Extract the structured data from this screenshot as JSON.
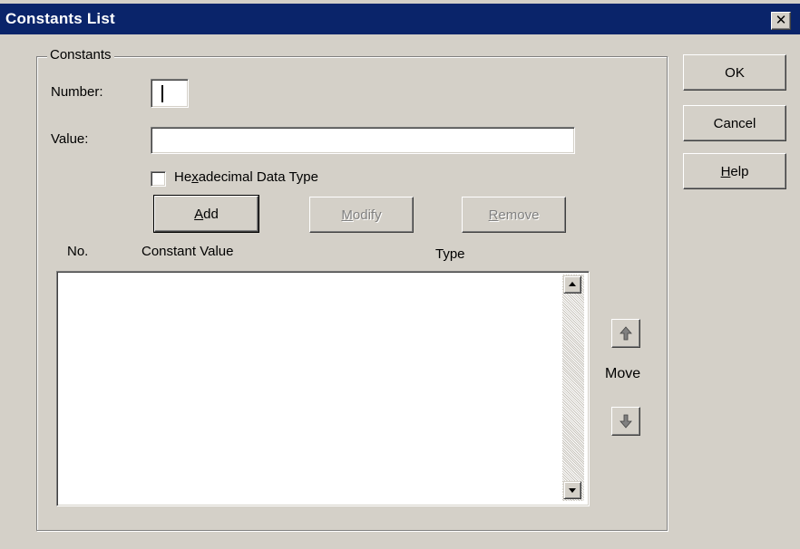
{
  "window": {
    "title": "Constants List",
    "close_label": "✕"
  },
  "group": {
    "label": "Constants"
  },
  "number": {
    "label": "Number:",
    "value": ""
  },
  "value": {
    "label": "Value:",
    "value": ""
  },
  "hex": {
    "label_pre": "He",
    "label_access": "x",
    "label_post": "adecimal Data Type",
    "checked": false
  },
  "buttons": {
    "add": {
      "access": "A",
      "rest": "dd"
    },
    "modify": {
      "access": "M",
      "rest": "odify"
    },
    "remove": {
      "access": "R",
      "rest": "emove"
    },
    "ok": "OK",
    "cancel": "Cancel",
    "help": {
      "access": "H",
      "rest": "elp"
    }
  },
  "columns": [
    "No.",
    "Constant Value",
    "Type"
  ],
  "rows": [],
  "move": {
    "label": "Move"
  },
  "icons": {
    "move_up": "up-arrow-icon",
    "move_down": "down-arrow-icon"
  }
}
